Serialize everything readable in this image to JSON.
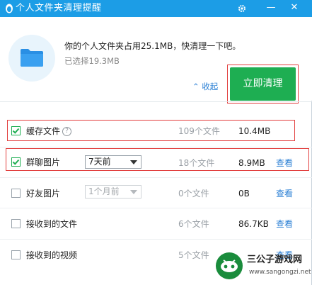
{
  "window": {
    "title": "个人文件夹清理提醒",
    "controls": {
      "settings_icon": "gear-icon",
      "minimize_label": "—",
      "close_label": "✕"
    }
  },
  "header": {
    "message": "你的个人文件夹占用25.1MB，快清理一下吧。",
    "selected_text": "已选择19.3MB",
    "collapse_label": "⌃ 收起",
    "clean_button_label": "立即清理"
  },
  "rows": [
    {
      "label": "缓存文件",
      "checked": true,
      "has_help": true,
      "count": "109个文件",
      "size": "10.4MB",
      "view": ""
    },
    {
      "label": "群聊图片",
      "checked": true,
      "select": "7天前",
      "select_disabled": false,
      "count": "18个文件",
      "size": "8.9MB",
      "view": "查看"
    },
    {
      "label": "好友图片",
      "checked": false,
      "select": "1个月前",
      "select_disabled": true,
      "count": "0个文件",
      "size": "0B",
      "view": "查看"
    },
    {
      "label": "接收到的文件",
      "checked": false,
      "count": "6个文件",
      "size": "86.7KB",
      "view": "查看"
    },
    {
      "label": "接收到的视频",
      "checked": false,
      "count": "5个文件",
      "size": "",
      "view": "查看"
    }
  ],
  "watermark": {
    "title": "三公子游戏网",
    "url": "www.sangongzi.net"
  },
  "colors": {
    "titlebar": "#1c9de6",
    "primary_button": "#1eae52",
    "link": "#2a7fd4",
    "highlight_box": "#e2403f"
  }
}
